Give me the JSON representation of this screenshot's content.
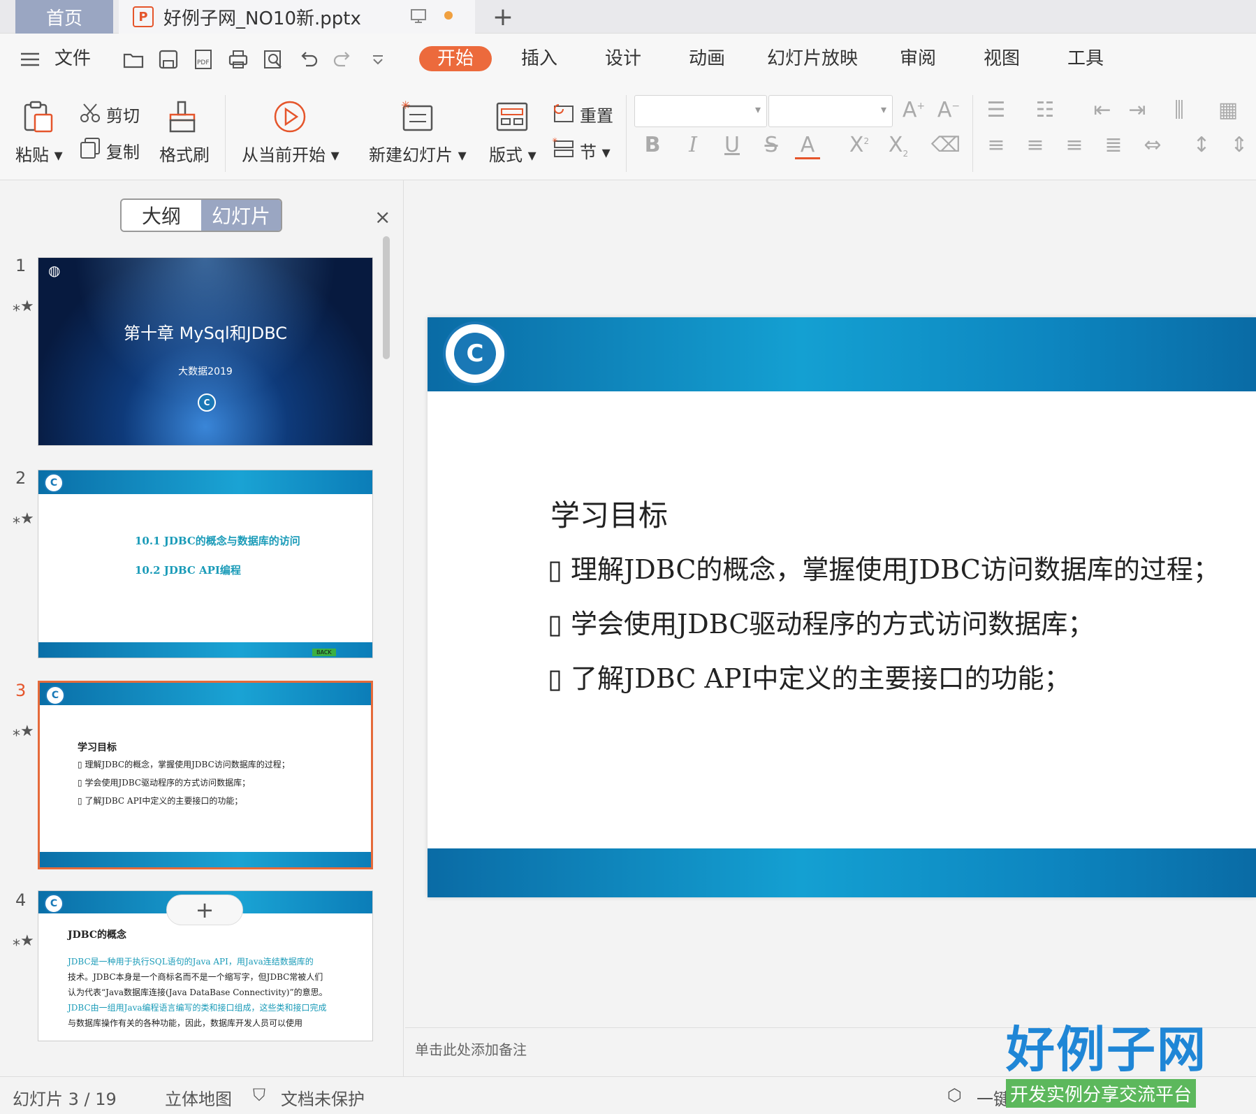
{
  "tabs": {
    "home": "首页",
    "doc_title": "好例子网_NO10新.pptx",
    "new_tab": "+"
  },
  "menu": {
    "file": "文件",
    "items": [
      "开始",
      "插入",
      "设计",
      "动画",
      "幻灯片放映",
      "审阅",
      "视图",
      "工具"
    ]
  },
  "ribbon": {
    "paste": "粘贴",
    "cut": "剪切",
    "copy": "复制",
    "format_painter": "格式刷",
    "play_from_current": "从当前开始",
    "new_slide": "新建幻灯片",
    "layout": "版式",
    "reset": "重置",
    "section": "节"
  },
  "leftpane": {
    "outline_tab": "大纲",
    "slides_tab": "幻灯片",
    "close": "×",
    "add": "+"
  },
  "thumbnails": [
    {
      "num": "1",
      "title": "第十章 MySql和JDBC",
      "subtitle": "大数据2019"
    },
    {
      "num": "2",
      "lines": [
        "10.1  JDBC的概念与数据库的访问",
        "10.2  JDBC API编程"
      ],
      "back": "BACK"
    },
    {
      "num": "3",
      "heading": "学习目标",
      "lines": [
        "理解JDBC的概念，掌握使用JDBC访问数据库的过程；",
        "学会使用JDBC驱动程序的方式访问数据库；",
        "了解JDBC API中定义的主要接口的功能；"
      ]
    },
    {
      "num": "4",
      "heading": "JDBC的概念",
      "lines": [
        "JDBC是一种用于执行SQL语句的Java API，用Java连结数据库的",
        "技术。JDBC本身是一个商标名而不是一个缩写字，但JDBC常被人们",
        "认为代表“Java数据库连接(Java DataBase Connectivity)”的意思。",
        "JDBC由一组用Java编程语言编写的类和接口组成，这些类和接口完成",
        "与数据库操作有关的各种功能，因此，数据库开发人员可以使用"
      ]
    }
  ],
  "slide": {
    "heading": "学习目标",
    "bullets": [
      "理解JDBC的概念，掌握使用JDBC访问数据库的过程；",
      "学会使用JDBC驱动程序的方式访问数据库；",
      "了解JDBC API中定义的主要接口的功能；"
    ],
    "bullet_glyph": "▯",
    "notes_placeholder": "单击此处添加备注"
  },
  "status": {
    "slide_counter": "幻灯片 3 / 19",
    "theme": "立体地图",
    "protection": "文档未保护",
    "one_key": "一键"
  },
  "brand": {
    "name": "好例子网",
    "tagline": "开发实例分享交流平台"
  },
  "colors": {
    "accent": "#ec6a3c",
    "tab_home": "#9aa6c2",
    "slide_band": "#14a0d2",
    "brand_blue": "#1f86d6",
    "brand_green": "#5cb85c"
  }
}
